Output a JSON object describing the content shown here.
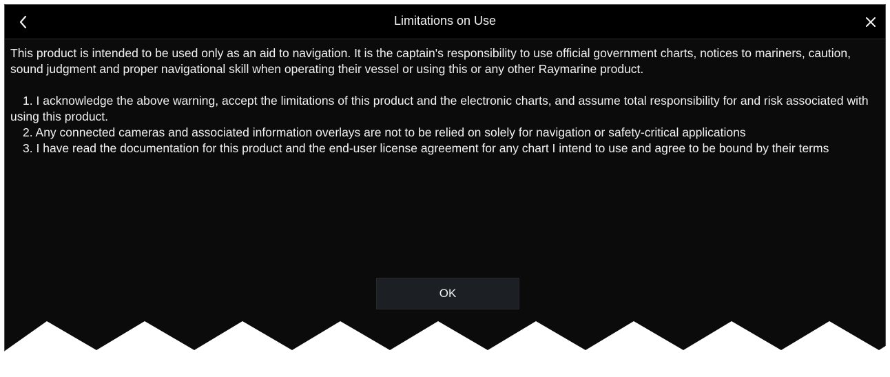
{
  "dialog": {
    "title": "Limitations on Use",
    "intro": "This product is intended to be used only as an aid to navigation. It is the captain's responsibility to use official government charts, notices to mariners, caution, sound judgment and proper navigational skill when operating their vessel or using this or any other Raymarine product.",
    "items": [
      {
        "number": "1.",
        "text": "I acknowledge the above warning, accept the limitations of this product and the electronic charts, and assume total responsibility for and risk associated with using this product."
      },
      {
        "number": "2.",
        "text": "Any connected cameras and associated information overlays are not to be relied on solely for navigation or safety-critical applications"
      },
      {
        "number": "3.",
        "text": "I have read the documentation for this product and the end-user license agreement for any chart I intend to use and agree to be bound by their terms"
      }
    ],
    "ok_label": "OK",
    "back_icon": "chevron-left-icon",
    "close_icon": "close-icon"
  }
}
